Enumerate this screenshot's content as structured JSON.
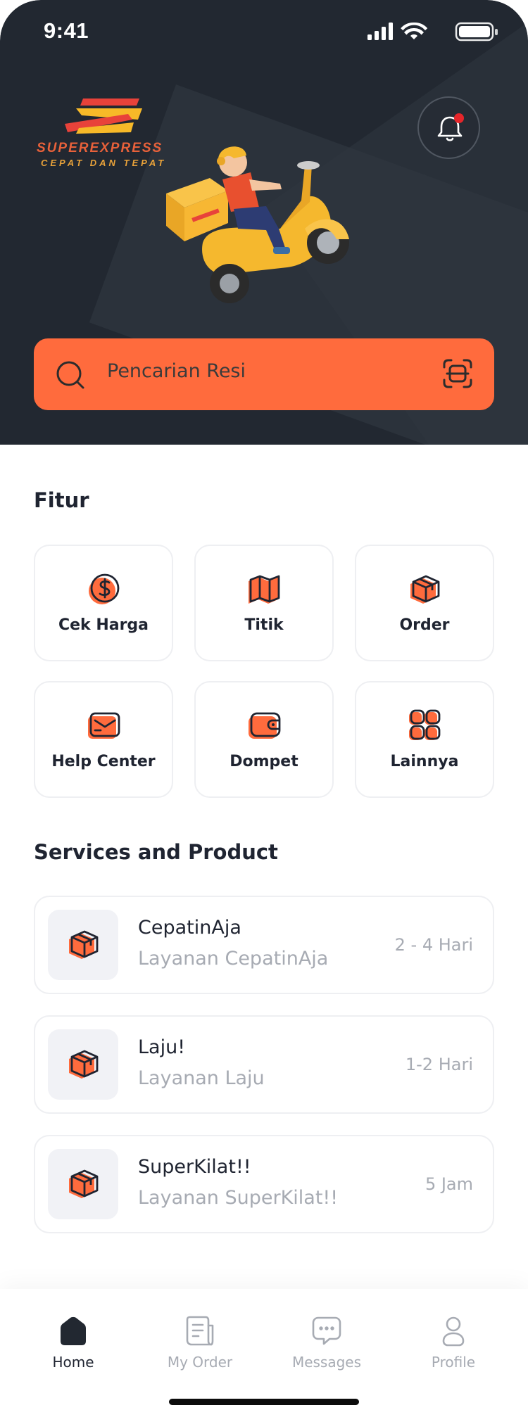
{
  "status_bar": {
    "time": "9:41"
  },
  "brand": {
    "name": "SUPEREXPRESS",
    "tagline": "CEPAT DAN TEPAT"
  },
  "search": {
    "placeholder": "Pencarian Resi"
  },
  "features": {
    "title": "Fitur",
    "items": [
      {
        "label": "Cek Harga",
        "icon": "dollar-coin-icon"
      },
      {
        "label": "Titik",
        "icon": "map-icon"
      },
      {
        "label": "Order",
        "icon": "package-icon"
      },
      {
        "label": "Help Center",
        "icon": "mail-icon"
      },
      {
        "label": "Dompet",
        "icon": "wallet-icon"
      },
      {
        "label": "Lainnya",
        "icon": "grid-icon"
      }
    ]
  },
  "services": {
    "title": "Services and Product",
    "items": [
      {
        "name": "CepatinAja",
        "description": "Layanan CepatinAja",
        "duration": "2 - 4 Hari"
      },
      {
        "name": "Laju!",
        "description": "Layanan Laju",
        "duration": "1-2 Hari"
      },
      {
        "name": "SuperKilat!!",
        "description": "Layanan SuperKilat!!",
        "duration": "5 Jam"
      }
    ]
  },
  "tab_bar": {
    "items": [
      {
        "label": "Home",
        "icon": "home-icon",
        "active": true
      },
      {
        "label": "My Order",
        "icon": "receipt-icon",
        "active": false
      },
      {
        "label": "Messages",
        "icon": "chat-icon",
        "active": false
      },
      {
        "label": "Profile",
        "icon": "user-icon",
        "active": false
      }
    ]
  },
  "colors": {
    "accent": "#ff6b3d",
    "header_bg": "#222831",
    "text_dark": "#1f2431",
    "text_muted": "#a7abb3"
  }
}
